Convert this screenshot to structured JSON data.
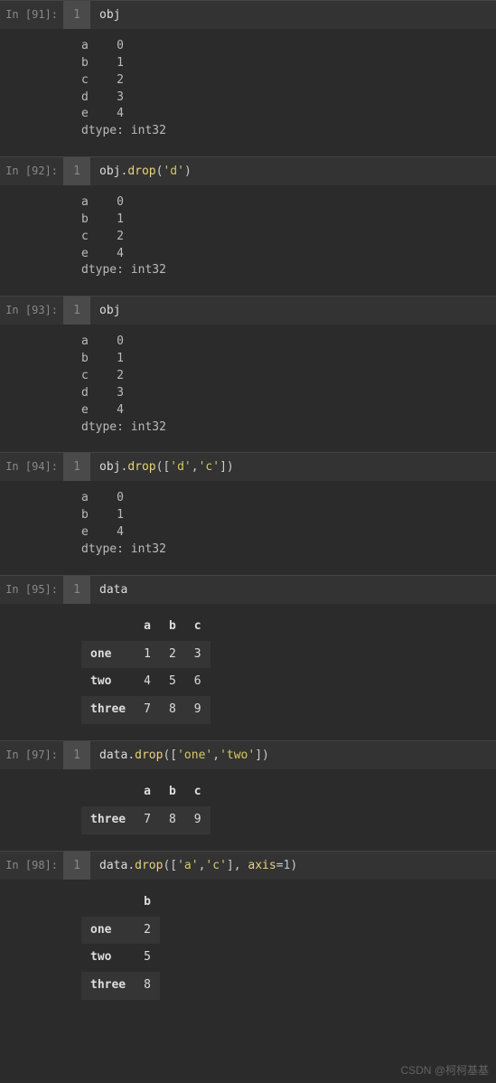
{
  "cells": [
    {
      "prompt": "In [91]:",
      "lineno": "1",
      "code": [
        {
          "t": "id",
          "v": "obj"
        }
      ],
      "out_type": "series",
      "series": {
        "rows": [
          [
            "a",
            "0"
          ],
          [
            "b",
            "1"
          ],
          [
            "c",
            "2"
          ],
          [
            "d",
            "3"
          ],
          [
            "e",
            "4"
          ]
        ],
        "dtype": "dtype: int32"
      }
    },
    {
      "prompt": "In [92]:",
      "lineno": "1",
      "code": [
        {
          "t": "id",
          "v": "obj"
        },
        {
          "t": "punc",
          "v": "."
        },
        {
          "t": "fn",
          "v": "drop"
        },
        {
          "t": "punc",
          "v": "("
        },
        {
          "t": "str",
          "v": "'d'"
        },
        {
          "t": "punc",
          "v": ")"
        }
      ],
      "out_type": "series",
      "series": {
        "rows": [
          [
            "a",
            "0"
          ],
          [
            "b",
            "1"
          ],
          [
            "c",
            "2"
          ],
          [
            "e",
            "4"
          ]
        ],
        "dtype": "dtype: int32"
      }
    },
    {
      "prompt": "In [93]:",
      "lineno": "1",
      "code": [
        {
          "t": "id",
          "v": "obj"
        }
      ],
      "out_type": "series",
      "series": {
        "rows": [
          [
            "a",
            "0"
          ],
          [
            "b",
            "1"
          ],
          [
            "c",
            "2"
          ],
          [
            "d",
            "3"
          ],
          [
            "e",
            "4"
          ]
        ],
        "dtype": "dtype: int32"
      }
    },
    {
      "prompt": "In [94]:",
      "lineno": "1",
      "code": [
        {
          "t": "id",
          "v": "obj"
        },
        {
          "t": "punc",
          "v": "."
        },
        {
          "t": "fn",
          "v": "drop"
        },
        {
          "t": "punc",
          "v": "(["
        },
        {
          "t": "str",
          "v": "'d'"
        },
        {
          "t": "punc",
          "v": ","
        },
        {
          "t": "str",
          "v": "'c'"
        },
        {
          "t": "punc",
          "v": "])"
        }
      ],
      "out_type": "series",
      "series": {
        "rows": [
          [
            "a",
            "0"
          ],
          [
            "b",
            "1"
          ],
          [
            "e",
            "4"
          ]
        ],
        "dtype": "dtype: int32"
      }
    },
    {
      "prompt": "In [95]:",
      "lineno": "1",
      "code": [
        {
          "t": "id",
          "v": "data"
        }
      ],
      "out_type": "frame",
      "frame": {
        "cols": [
          "a",
          "b",
          "c"
        ],
        "idx": [
          "one",
          "two",
          "three"
        ],
        "vals": [
          [
            "1",
            "2",
            "3"
          ],
          [
            "4",
            "5",
            "6"
          ],
          [
            "7",
            "8",
            "9"
          ]
        ]
      }
    },
    {
      "prompt": "In [97]:",
      "lineno": "1",
      "code": [
        {
          "t": "id",
          "v": "data"
        },
        {
          "t": "punc",
          "v": "."
        },
        {
          "t": "fn",
          "v": "drop"
        },
        {
          "t": "punc",
          "v": "(["
        },
        {
          "t": "str",
          "v": "'one'"
        },
        {
          "t": "punc",
          "v": ","
        },
        {
          "t": "str",
          "v": "'two'"
        },
        {
          "t": "punc",
          "v": "])"
        }
      ],
      "out_type": "frame",
      "frame": {
        "cols": [
          "a",
          "b",
          "c"
        ],
        "idx": [
          "three"
        ],
        "vals": [
          [
            "7",
            "8",
            "9"
          ]
        ]
      }
    },
    {
      "prompt": "In [98]:",
      "lineno": "1",
      "code": [
        {
          "t": "id",
          "v": "data"
        },
        {
          "t": "punc",
          "v": "."
        },
        {
          "t": "fn",
          "v": "drop"
        },
        {
          "t": "punc",
          "v": "(["
        },
        {
          "t": "str",
          "v": "'a'"
        },
        {
          "t": "punc",
          "v": ","
        },
        {
          "t": "str",
          "v": "'c'"
        },
        {
          "t": "punc",
          "v": "], "
        },
        {
          "t": "kw",
          "v": "axis"
        },
        {
          "t": "punc",
          "v": "="
        },
        {
          "t": "num",
          "v": "1"
        },
        {
          "t": "punc",
          "v": ")"
        }
      ],
      "out_type": "frame",
      "frame": {
        "cols": [
          "b"
        ],
        "idx": [
          "one",
          "two",
          "three"
        ],
        "vals": [
          [
            "2"
          ],
          [
            "5"
          ],
          [
            "8"
          ]
        ]
      }
    }
  ],
  "watermark": "CSDN @柯柯基基"
}
